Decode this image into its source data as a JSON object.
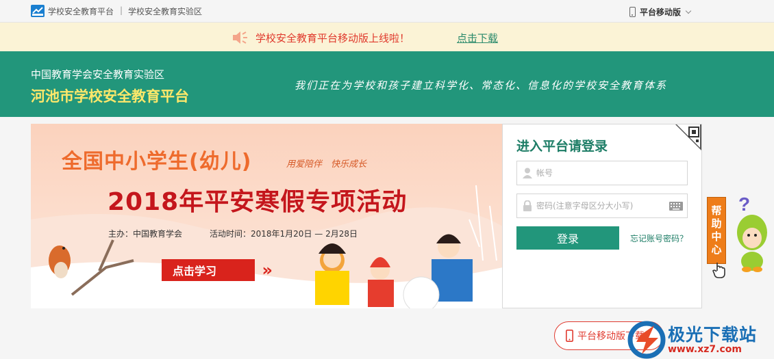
{
  "topbar": {
    "platform_link": "学校安全教育平台",
    "separator": "|",
    "zone_link": "学校安全教育实验区",
    "mobile_label": "平台移动版"
  },
  "notice": {
    "text": "学校安全教育平台移动版上线啦！",
    "link": "点击下载"
  },
  "header": {
    "org": "中国教育学会安全教育实验区",
    "title": "河池市学校安全教育平台",
    "slogan": "我们正在为学校和孩子建立科学化、常态化、信息化的学校安全教育体系"
  },
  "banner": {
    "line1": "全国中小学生(幼儿)",
    "subtitle": "用爱陪伴　快乐成长",
    "line2": "2018年平安寒假专项活动",
    "host": "主办：中国教育学会",
    "time": "活动时间：2018年1月20日 — 2月28日",
    "study_button": "点击学习"
  },
  "login": {
    "title": "进入平台请登录",
    "account_placeholder": "帐号",
    "password_placeholder": "密码(注意字母区分大小写)",
    "login_button": "登录",
    "forgot_link": "忘记账号密码？"
  },
  "help": {
    "chars": [
      "帮",
      "助",
      "中",
      "心"
    ]
  },
  "footer": {
    "mobile_button": "平台移动版下载"
  },
  "watermark": {
    "name": "极光下载站",
    "url": "www.xz7.com"
  },
  "colors": {
    "primary": "#22967b",
    "title_yellow": "#ffe86a",
    "notice_bg": "#fbf3d6",
    "notice_red": "#e0392c",
    "help_orange": "#ee7d1a"
  },
  "icons": [
    "logo-icon",
    "phone-icon",
    "chevron-down-icon",
    "speaker-icon",
    "qr-code-icon",
    "user-icon",
    "lock-icon",
    "keyboard-icon",
    "pointer-hand-icon"
  ]
}
